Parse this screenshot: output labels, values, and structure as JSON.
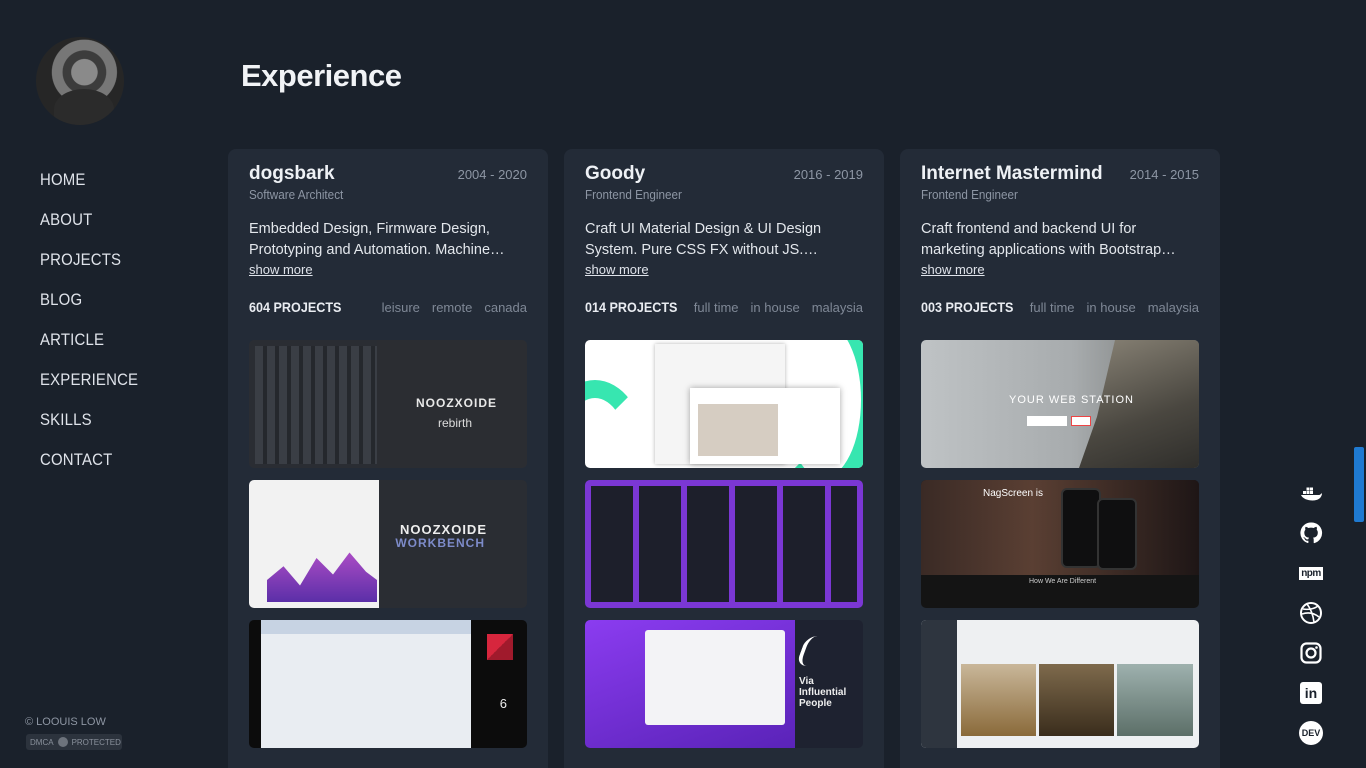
{
  "sidebar": {
    "nav": [
      "HOME",
      "ABOUT",
      "PROJECTS",
      "BLOG",
      "ARTICLE",
      "EXPERIENCE",
      "SKILLS",
      "CONTACT"
    ],
    "copyright": "© LOOUIS LOW",
    "dmca_left": "DMCA",
    "dmca_right": "PROTECTED"
  },
  "main": {
    "title": "Experience",
    "show_more": "show more",
    "cards": [
      {
        "company": "dogsbark",
        "years": "2004 - 2020",
        "role": "Software Architect",
        "desc": "Embedded Design, Firmware Design, Prototyping and Automation. Machine…",
        "count": "604 PROJECTS",
        "tags": [
          "leisure",
          "remote",
          "canada"
        ],
        "shot_text": {
          "a1": "NOOZXOIDE",
          "a2": "rebirth",
          "b1": "NOOZXOIDE",
          "b2": "WORKBENCH",
          "c1": "6"
        }
      },
      {
        "company": "Goody",
        "years": "2016 - 2019",
        "role": "Frontend Engineer",
        "desc": "Craft UI Material Design & UI Design System. Pure CSS FX without JS. Create…",
        "count": "014 PROJECTS",
        "tags": [
          "full time",
          "in house",
          "malaysia"
        ],
        "shot_text": {
          "c1": "Via Influential People"
        }
      },
      {
        "company": "Internet Mastermind",
        "years": "2014 - 2015",
        "role": "Frontend Engineer",
        "desc": "Craft frontend and backend UI for marketing applications with Bootstrap…",
        "count": "003 PROJECTS",
        "tags": [
          "full time",
          "in house",
          "malaysia"
        ],
        "shot_text": {
          "a1": "YOUR WEB STATION",
          "b1": "NagScreen is",
          "b2": "How We Are Different"
        }
      }
    ]
  },
  "socials": [
    "docker-icon",
    "github-icon",
    "npm-icon",
    "dribbble-icon",
    "instagram-icon",
    "linkedin-icon",
    "dev-icon"
  ],
  "social_text": {
    "npm": "npm",
    "linkedin": "in",
    "dev": "DEV"
  }
}
